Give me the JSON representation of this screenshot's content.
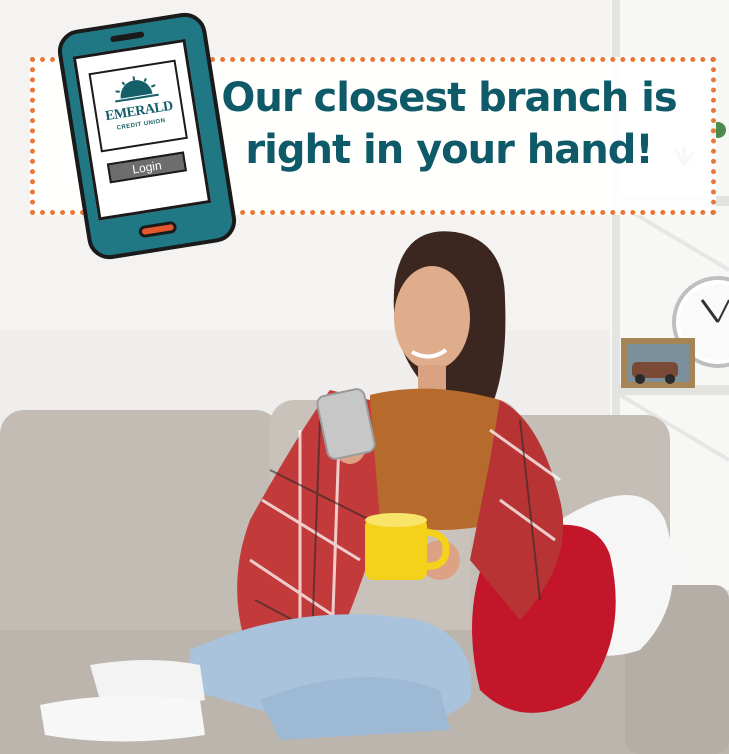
{
  "banner": {
    "headline_line1": "Our closest branch is",
    "headline_line2": "right in your hand!"
  },
  "phone_app": {
    "logo_name": "EMERALD",
    "logo_subtitle": "CREDIT UNION",
    "login_label": "Login"
  },
  "photo_elements": [
    "woman-on-couch",
    "smartphone",
    "yellow-mug",
    "plaid-blanket",
    "red-pillow",
    "white-pillow",
    "wall-clock",
    "picture-frame",
    "bookshelf",
    "plant"
  ],
  "colors": {
    "headline": "#0e5a68",
    "banner_border": "#e8773a",
    "phone_body": "#1f7884",
    "phone_home_button": "#e4582d",
    "logo_text": "#145f68"
  }
}
